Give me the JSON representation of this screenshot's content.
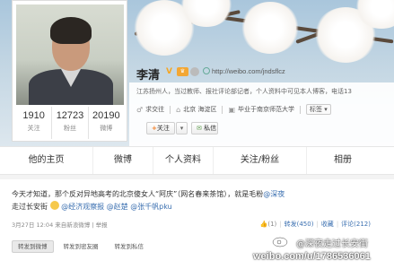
{
  "profile": {
    "name": "李清",
    "url": "http://weibo.com/jndsflcz",
    "intro": "江苏扬州人，当过教师、报社评论部记者，个人资料中可见本人博客，电话13",
    "location": "北京 海淀区",
    "gender_label": "求交往",
    "school": "毕业于南京师范大学",
    "more_label": "标签"
  },
  "stats": [
    {
      "value": "1910",
      "label": "关注"
    },
    {
      "value": "12723",
      "label": "粉丝"
    },
    {
      "value": "20190",
      "label": "微博"
    }
  ],
  "buttons": {
    "follow": "关注",
    "dropdown": "▾",
    "message": "私信"
  },
  "tabs": [
    "他的主页",
    "微博",
    "个人资料",
    "关注/粉丝",
    "相册"
  ],
  "post": {
    "text_1": "今天才知道，那个反对异地高考的北京傻女人“阿庆”（网名春来茶馆），就是毛粉",
    "mention_1": "@深夜",
    "text_2": "走过长安街",
    "mention_2": "@经济观察报",
    "mention_3": "@赵楚",
    "mention_4": "@张千帆pku",
    "time": "3月27日 12:04",
    "source": "来自新浪微博 | 举报",
    "like_count": "(1)",
    "repost": "转发(450)",
    "favorite": "收藏",
    "comment": "评论(212)"
  },
  "repost_buttons": [
    "转发到微博",
    "转发到密友圈",
    "转发到私信"
  ],
  "watermark": {
    "handle": "@深夜走过长安街",
    "url": "weibo.com/u/1786536061"
  },
  "colors": {
    "link": "#3a6fb0",
    "accent_orange": "#f47b20",
    "vip_badge": "#f3a734"
  }
}
